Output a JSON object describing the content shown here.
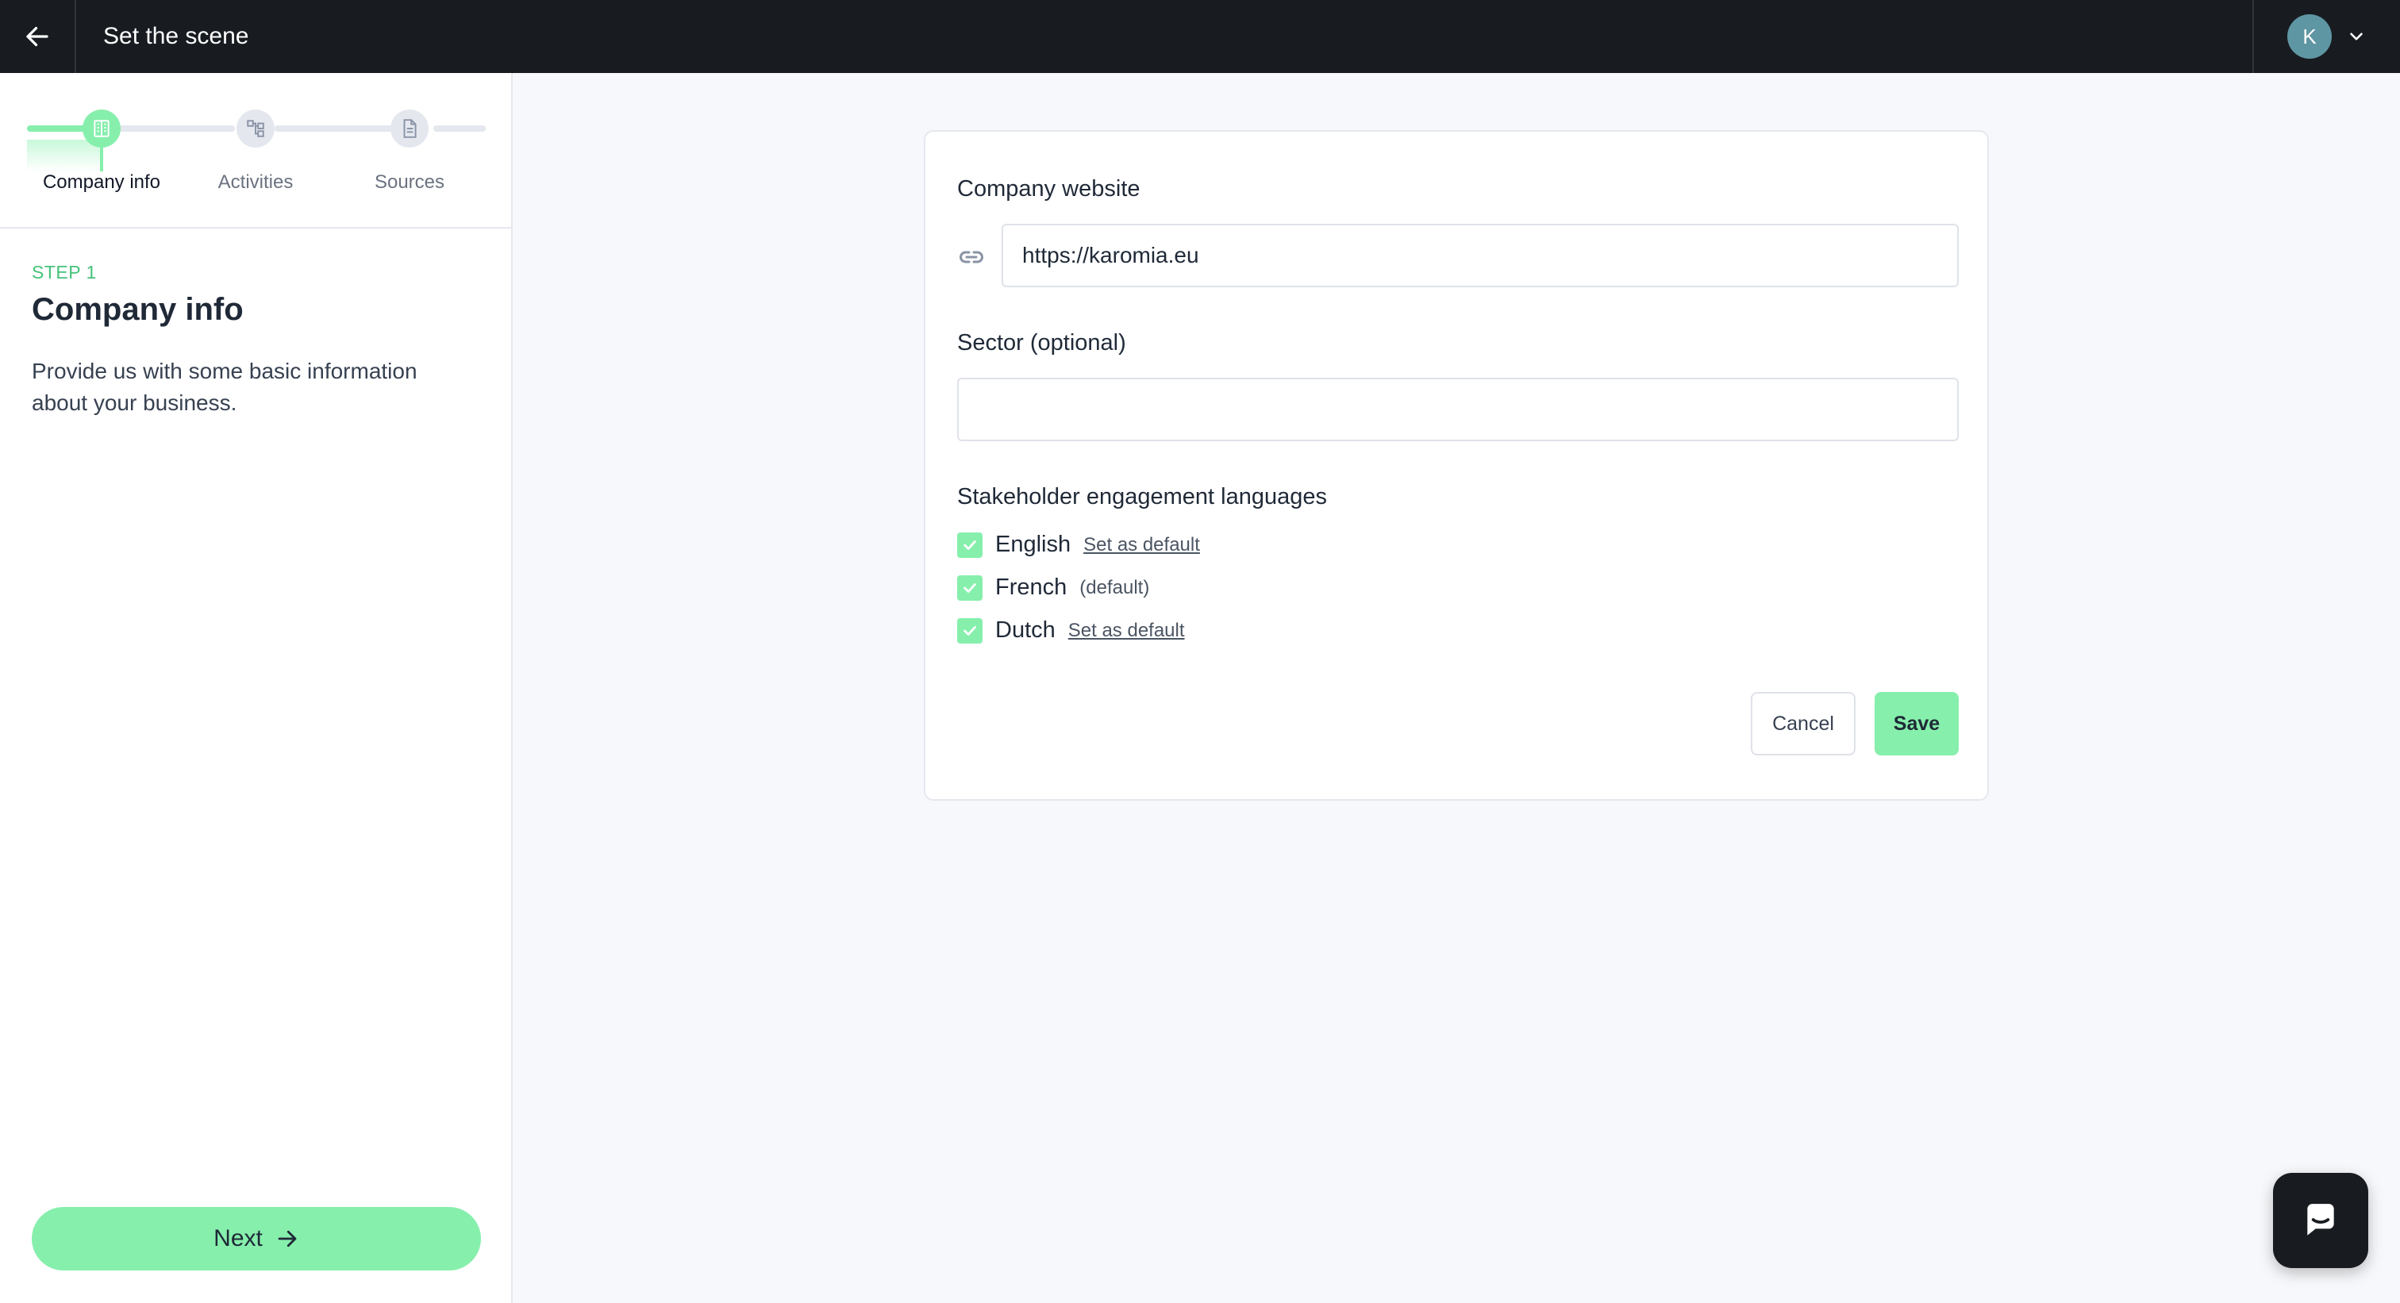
{
  "header": {
    "title": "Set the scene",
    "back_icon": "arrow-left-icon",
    "user_initial": "K",
    "menu_icon": "chevron-down-icon"
  },
  "stepper": {
    "steps": [
      {
        "label": "Company info",
        "icon": "building-icon",
        "state": "active"
      },
      {
        "label": "Activities",
        "icon": "flow-icon",
        "state": "upcoming"
      },
      {
        "label": "Sources",
        "icon": "document-icon",
        "state": "upcoming"
      }
    ]
  },
  "step": {
    "kicker": "STEP 1",
    "title": "Company info",
    "description": "Provide us with some basic information about your business."
  },
  "next_button": {
    "label": "Next",
    "icon": "arrow-right-icon"
  },
  "form": {
    "website": {
      "label": "Company website",
      "value": "https://karomia.eu",
      "icon": "link-icon"
    },
    "sector": {
      "label": "Sector (optional)",
      "value": ""
    },
    "languages": {
      "label": "Stakeholder engagement languages",
      "items": [
        {
          "name": "English",
          "checked": true,
          "action": "Set as default"
        },
        {
          "name": "French",
          "checked": true,
          "tag": "(default)"
        },
        {
          "name": "Dutch",
          "checked": true,
          "action": "Set as default"
        }
      ]
    },
    "cancel_label": "Cancel",
    "save_label": "Save"
  },
  "chat": {
    "icon": "chat-icon"
  },
  "colors": {
    "accent": "#86efac",
    "topbar": "#181c21",
    "kicker": "#45c27a"
  }
}
